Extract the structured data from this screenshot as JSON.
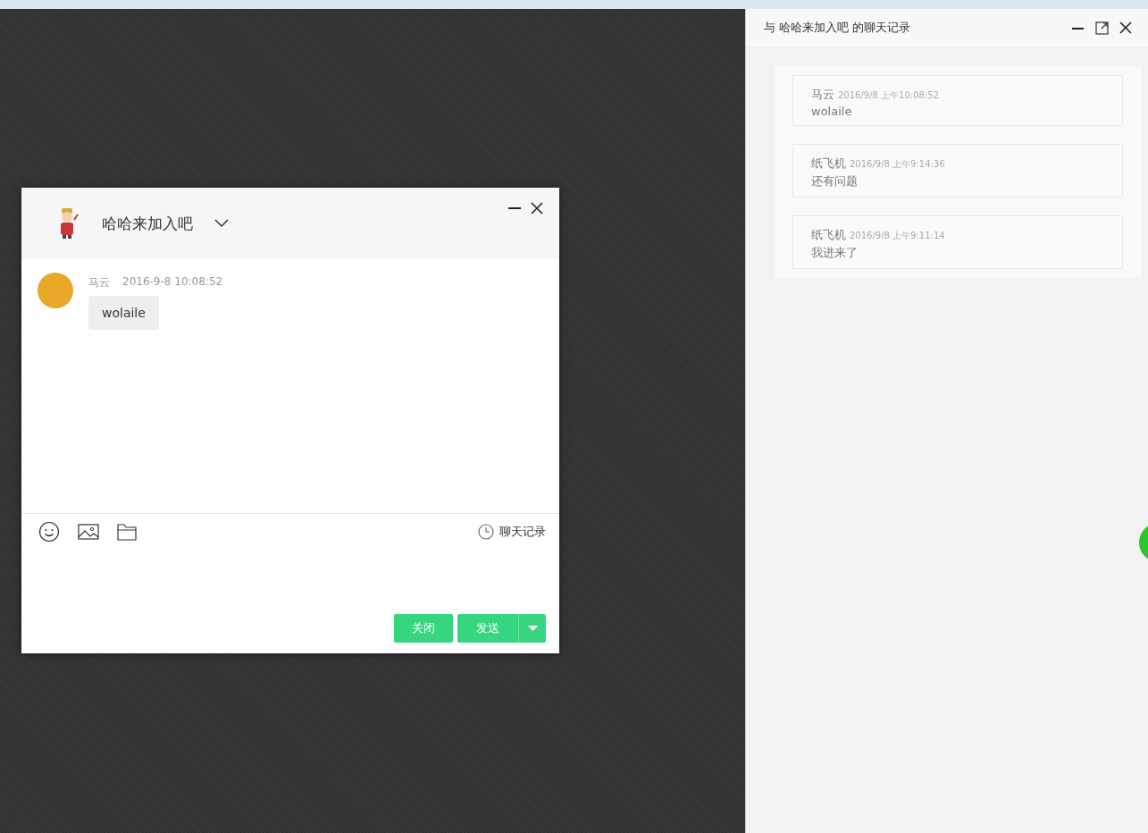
{
  "chat_window": {
    "title": "哈哈来加入吧",
    "messages": [
      {
        "sender": "马云",
        "time": "2016-9-8 10:08:52",
        "text": "wolaile"
      }
    ],
    "history_link": "聊天记录",
    "close_button": "关闭",
    "send_button": "发送"
  },
  "history_panel": {
    "title": "与 哈哈来加入吧 的聊天记录",
    "records": [
      {
        "sender": "马云",
        "time": "2016/9/8 上午10:08:52",
        "text": "wolaile"
      },
      {
        "sender": "纸飞机",
        "time": "2016/9/8 上午9:14:36",
        "text": "还有问题"
      },
      {
        "sender": "纸飞机",
        "time": "2016/9/8 上午9:11:14",
        "text": "我进来了"
      }
    ]
  }
}
